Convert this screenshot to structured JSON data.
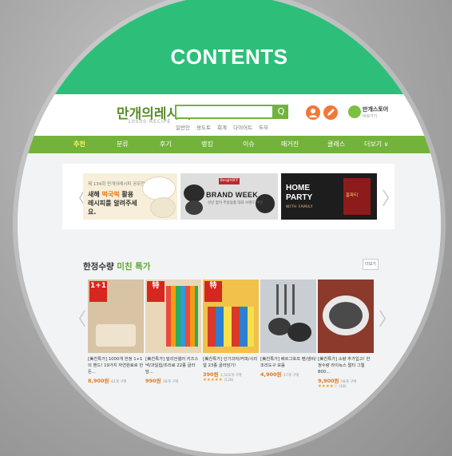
{
  "caption": "CONTENTS",
  "site": {
    "logo": "만개의레시피",
    "logo_sub": "10000 RECIPE",
    "search_placeholder": "",
    "search_button": "Q",
    "keywords": [
      "일반인",
      "쌍도토",
      "회계",
      "다이어트",
      "두부"
    ],
    "store_name": "만개스토어",
    "store_sub": "바로가기"
  },
  "nav": {
    "items": [
      "추천",
      "분류",
      "후기",
      "랭킹",
      "이슈",
      "매거진",
      "클래스",
      "더보기 ∨"
    ]
  },
  "banners": [
    {
      "small": "제 134회 만개의레시피 공모전",
      "big_1": "새해 ",
      "big_hl": "떡국떡",
      "big_2": " 활용",
      "big_3": "레시피를 알려주세요."
    },
    {
      "brand": "BergHOFF",
      "title": "BRAND WEEK",
      "sub": "신년 맞이 주방용품 대표 브랜드 세일"
    },
    {
      "title_1": "HOME",
      "title_2": "PARTY",
      "sub": "WITH FAMILY",
      "side": "홈파티"
    }
  ],
  "arrows": {
    "left": "〈",
    "right": "〉"
  },
  "deals": {
    "title": "한정수량 ",
    "title_hl": "미친 특가",
    "more": "더보기",
    "products": [
      {
        "name": "[美친특가] 1000개 한정 1+1의 밴드! 19가지 자연원료로 만든...",
        "price": "8,900원",
        "meta": "42개 구매",
        "stars": "",
        "reviews": "",
        "badge": "1+1",
        "color": "#d8c3a5"
      },
      {
        "name": "[美친특가] 밀리언셀러 키즈스낵/과일칩/조리료 22종 골라담...",
        "price": "990원",
        "meta": "36개 구매",
        "stars": "",
        "reviews": "",
        "badge": "特",
        "color": "#e9d7b8"
      },
      {
        "name": "[美친특가] 인기과자/커피/시리얼 23종 골라담기!",
        "price": "390원",
        "meta": "1,503개 구매",
        "stars": "★★★★★",
        "reviews": "(128)",
        "badge": "特",
        "color": "#f2c14a"
      },
      {
        "name": "[美친특가] 베르그호프 펜/냄비/조리도구 모음",
        "price": "4,900원",
        "meta": "17개 구매",
        "stars": "",
        "reviews": "",
        "badge": "",
        "color": "#c9ced3"
      },
      {
        "name": "[美친특가] 소량 추가입고! 한정수량 라이녹스 멀티 그릴 800...",
        "price": "9,900원",
        "meta": "58개 구매",
        "stars": "★★★★☆",
        "reviews": "(18)",
        "badge": "",
        "color": "#8c3a2c"
      }
    ]
  },
  "colors": {
    "caption_bg": "#2dbf7a",
    "nav_bg": "#74b33b",
    "price": "#e2791d"
  }
}
